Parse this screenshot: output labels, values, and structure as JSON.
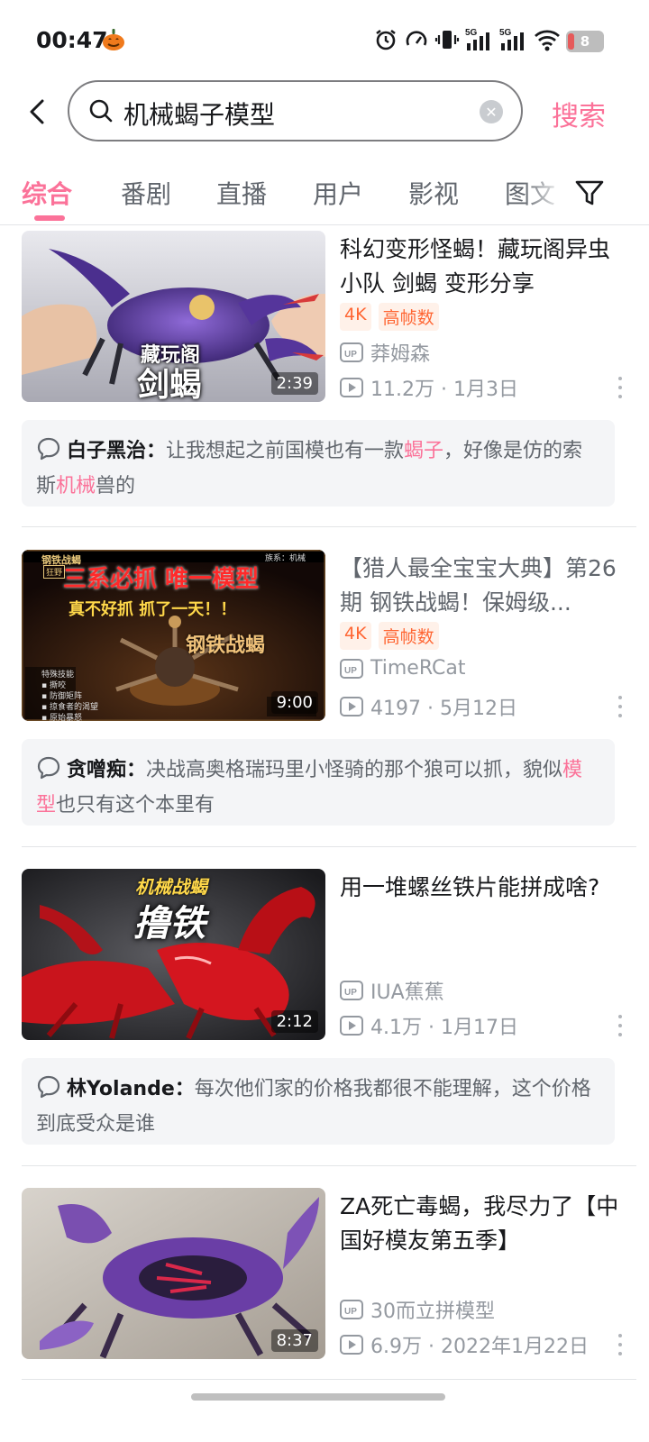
{
  "status_bar": {
    "time": "00:47",
    "battery": "8",
    "network_1": "5G",
    "network_2": "5G"
  },
  "search": {
    "query": "机械蝎子模型",
    "action_label": "搜索"
  },
  "tabs": [
    {
      "label": "综合"
    },
    {
      "label": "番剧"
    },
    {
      "label": "直播"
    },
    {
      "label": "用户"
    },
    {
      "label": "影视"
    },
    {
      "label": "图文"
    }
  ],
  "results": [
    {
      "title": "科幻变形怪蝎！藏玩阁异虫小队 剑蝎 变形分享",
      "badges": [
        "4K",
        "高帧数"
      ],
      "uploader": "莽姆森",
      "stats": "11.2万 · 1月3日",
      "duration": "2:39",
      "thumb_text": [
        "藏玩阁",
        "剑蝎"
      ],
      "comment": {
        "author": "白子黑治：",
        "parts": [
          "让我想起之前国模也有一款",
          "蝎子",
          "，好像是仿的索斯",
          "机械",
          "兽的"
        ]
      }
    },
    {
      "title": "【猎人最全宝宝大典】第26期 钢铁战蝎！保姆级...",
      "badges": [
        "4K",
        "高帧数"
      ],
      "uploader": "TimeRCat",
      "stats": "4197 · 5月12日",
      "duration": "9:00",
      "thumb_text": [
        "三系必抓 唯一模型",
        "真不好抓 抓了一天！！",
        "钢铁战蝎",
        "钢铁战蝎",
        "族系：机械",
        "特殊技能",
        "撕咬",
        "防御矩阵",
        "掠食者的渴望",
        "原始暴怒",
        "狂野"
      ],
      "comment": {
        "author": "贪噌痴：",
        "parts": [
          "决战高奥格瑞玛里小怪骑的那个狼可以抓，貌似",
          "模型",
          "也只有这个本里有"
        ]
      }
    },
    {
      "title": "用一堆螺丝铁片能拼成啥?",
      "badges": [],
      "uploader": "IUA蕉蕉",
      "stats": "4.1万 · 1月17日",
      "duration": "2:12",
      "thumb_text": [
        "机械战蝎",
        "撸铁"
      ],
      "comment": {
        "author": "林Yolande：",
        "parts": [
          "每次他们家的价格我都很不能理解，这个价格到底受众是谁"
        ]
      }
    },
    {
      "title": "ZA死亡毒蝎，我尽力了【中国好模友第五季】",
      "badges": [],
      "uploader": "30而立拼模型",
      "stats": "6.9万 · 2022年1月22日",
      "duration": "8:37",
      "thumb_text": []
    }
  ],
  "colors": {
    "accent": "#fb7299",
    "badge": "#ff6633",
    "text": "#18191c",
    "muted": "#9499a0"
  }
}
